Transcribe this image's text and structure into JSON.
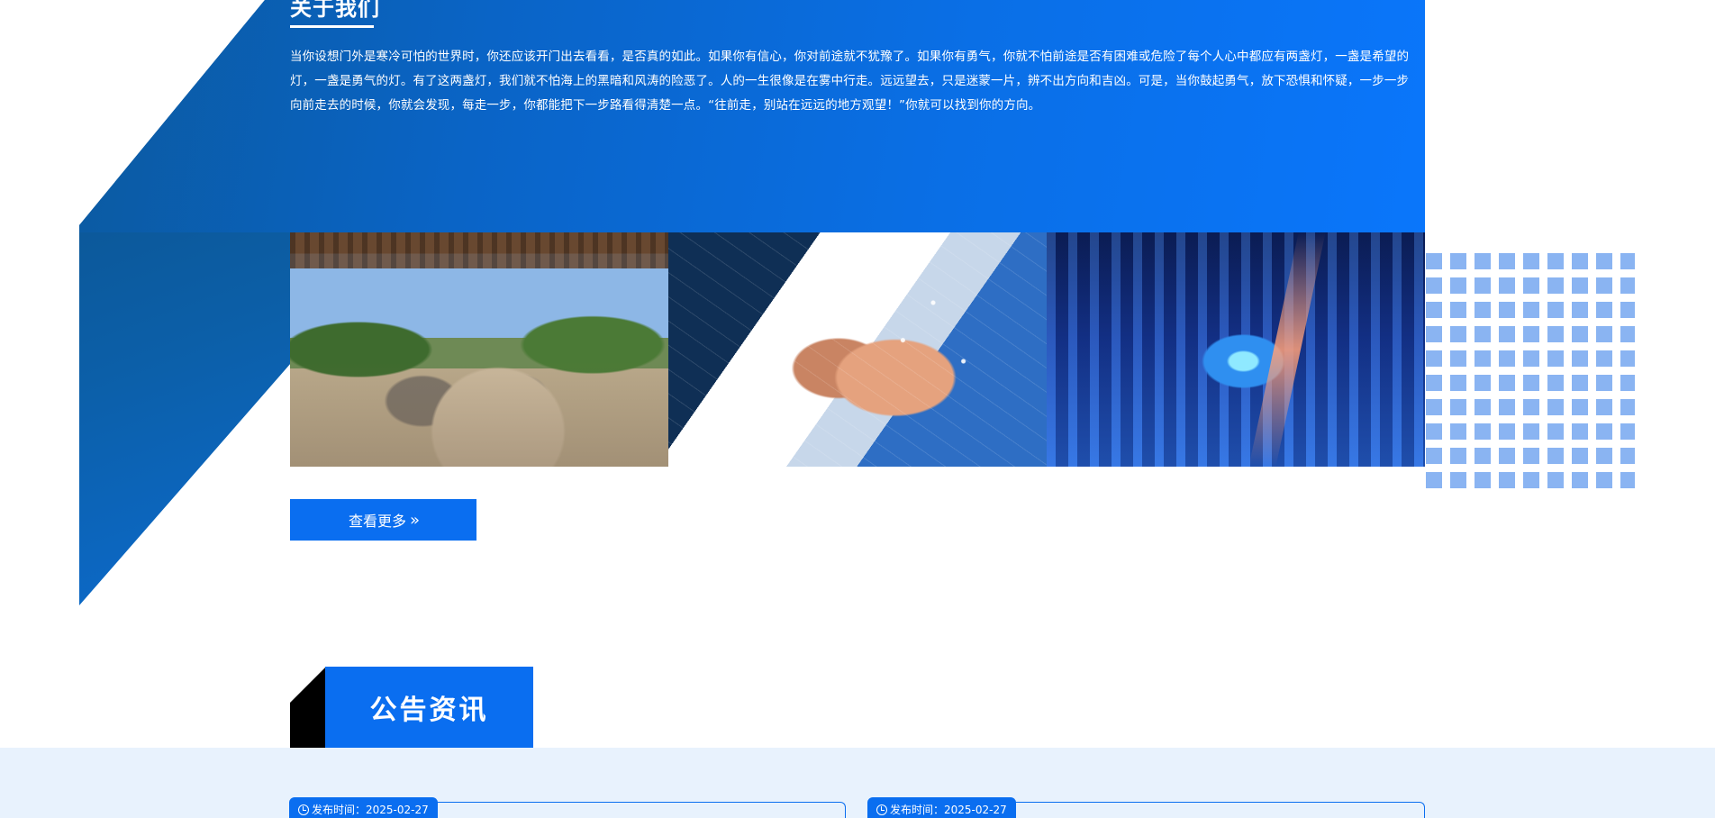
{
  "about": {
    "title": "关于我们",
    "text": "当你设想门外是寒冷可怕的世界时，你还应该开门出去看看，是否真的如此。如果你有信心，你对前途就不犹豫了。如果你有勇气，你就不怕前途是否有困难或危险了每个人心中都应有两盏灯，一盏是希望的灯，一盏是勇气的灯。有了这两盏灯，我们就不怕海上的黑暗和风涛的险恶了。人的一生很像是在雾中行走。远远望去，只是迷蒙一片，辨不出方向和吉凶。可是，当你鼓起勇气，放下恐惧和怀疑，一步一步向前走去的时候，你就会发现，每走一步，你都能把下一步路看得清楚一点。“往前走，别站在远远的地方观望！”你就可以找到你的方向。",
    "images": [
      "terrace-photo",
      "handshake-network-photo",
      "city-night-photo"
    ],
    "more_label": "查看更多",
    "more_icon": "double-chevron-right-icon"
  },
  "notice": {
    "title": "公告资讯",
    "cards": [
      {
        "date_label": "发布时间：2025-02-27"
      },
      {
        "date_label": "发布时间：2025-02-27"
      }
    ]
  },
  "colors": {
    "primary": "#0a6ef0",
    "dark_blue": "#0d4f86",
    "dots": "#8ab4f2",
    "notice_bg": "#e8f2fd"
  }
}
